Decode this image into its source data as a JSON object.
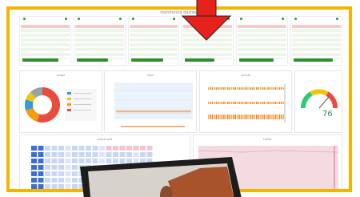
{
  "dashboard": {
    "title": "monitoring dashboard",
    "stats": [
      {
        "id": "s1",
        "level": 0.7
      },
      {
        "id": "s2",
        "level": 0.55
      },
      {
        "id": "s3",
        "level": 0.6
      },
      {
        "id": "s4",
        "level": 0.5
      },
      {
        "id": "s5",
        "level": 0.65
      },
      {
        "id": "s6",
        "level": 0.8
      }
    ],
    "donut": {
      "title": "usage",
      "segments": [
        {
          "color": "#e74c3c",
          "value": 55
        },
        {
          "color": "#f39c12",
          "value": 15
        },
        {
          "color": "#3498db",
          "value": 10
        },
        {
          "color": "#f1c40f",
          "value": 8
        },
        {
          "color": "#95a5a6",
          "value": 12
        }
      ]
    },
    "line_title": "load",
    "orange_title": "events",
    "gauge": {
      "value_label": "76",
      "level": 0.76,
      "colors": [
        "#2ecc71",
        "#f1c40f",
        "#e74c3c"
      ]
    },
    "table_title": "status grid",
    "area_title": "traffic",
    "accent": "#f5b400",
    "arrow_color": "#e8211b"
  }
}
